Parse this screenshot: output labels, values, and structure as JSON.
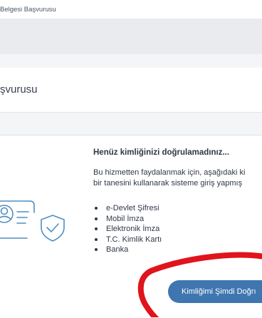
{
  "breadcrumb": {
    "current": "Belgesi Başvurusu"
  },
  "page": {
    "title": "şvurusu"
  },
  "info": {
    "heading": "Henüz kimliğinizi doğrulamadınız...",
    "text_line1": "Bu hizmetten faydalanmak için, aşağıdaki ki",
    "text_line2": "bir tanesini kullanarak sisteme giriş yapmış"
  },
  "methods": [
    "e-Devlet Şifresi",
    "Mobil İmza",
    "Elektronik İmza",
    "T.C. Kimlik Kartı",
    "Banka"
  ],
  "actions": {
    "verify_label": "Kimliğimi Şimdi Doğrı"
  },
  "colors": {
    "accent": "#3f76b0",
    "annotation": "#e0141c",
    "illustration": "#4f8fc2"
  },
  "icons": {
    "illustration": "identity-card-shield-icon"
  }
}
